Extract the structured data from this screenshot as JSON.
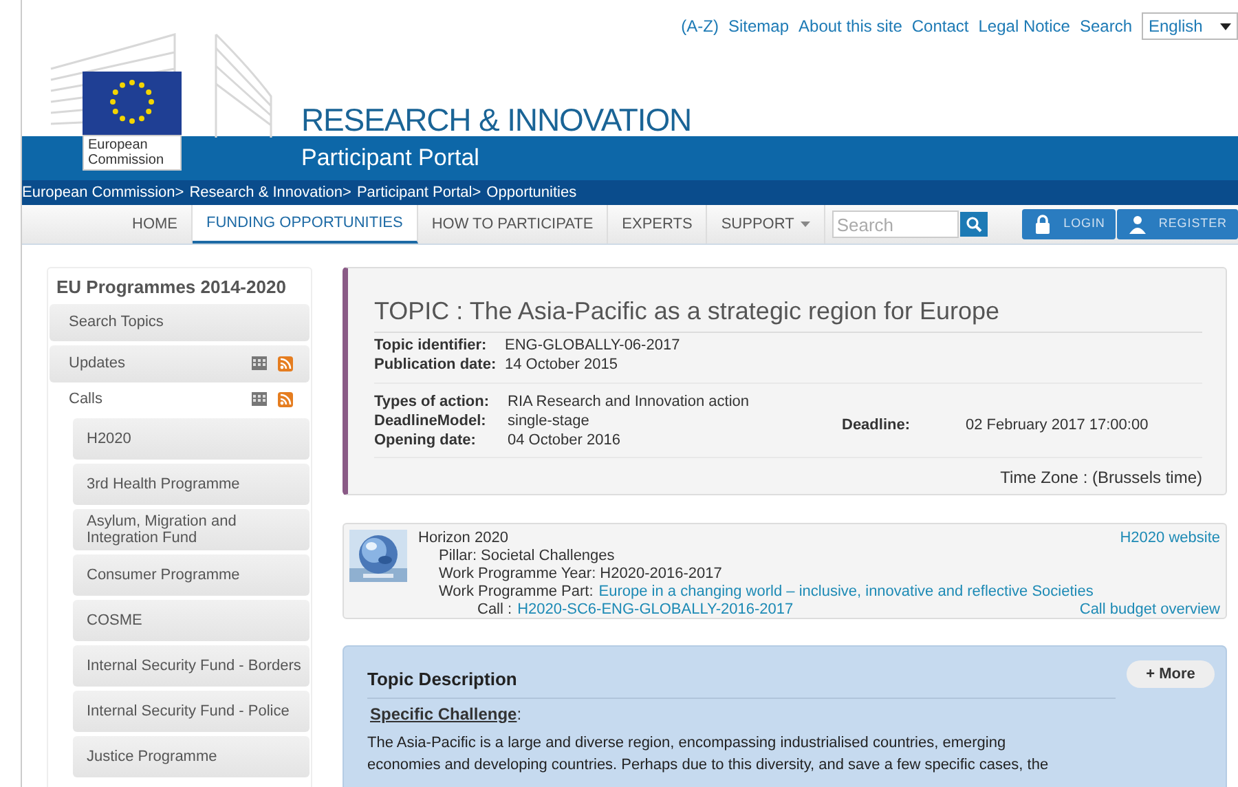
{
  "top_links": [
    "(A-Z)",
    "Sitemap",
    "About this site",
    "Contact",
    "Legal Notice",
    "Search"
  ],
  "language": {
    "value": "English"
  },
  "logo": {
    "line1": "European",
    "line2": "Commission"
  },
  "site_title": "RESEARCH & INNOVATION",
  "portal_title": "Participant Portal",
  "breadcrumb": [
    "European Commission",
    "Research & Innovation",
    "Participant Portal",
    "Opportunities"
  ],
  "breadcrumb_separator": ">",
  "nav": [
    {
      "label": "HOME",
      "selected": false,
      "dropdown": false
    },
    {
      "label": "FUNDING OPPORTUNITIES",
      "selected": true,
      "dropdown": false
    },
    {
      "label": "HOW TO PARTICIPATE",
      "selected": false,
      "dropdown": false
    },
    {
      "label": "EXPERTS",
      "selected": false,
      "dropdown": false
    },
    {
      "label": "SUPPORT",
      "selected": false,
      "dropdown": true
    }
  ],
  "search": {
    "placeholder": "Search"
  },
  "account_buttons": [
    {
      "label": "LOGIN",
      "kind": "lock"
    },
    {
      "label": "REGISTER",
      "kind": "user"
    }
  ],
  "sidebar": {
    "title": "EU Programmes 2014-2020",
    "items": [
      {
        "label": "Search Topics",
        "feeds": false
      },
      {
        "label": "Updates",
        "feeds": true
      },
      {
        "label": "Calls",
        "feeds": true,
        "children": [
          {
            "label": "H2020"
          },
          {
            "label": "3rd Health Programme"
          },
          {
            "label": "Asylum, Migration and Integration Fund"
          },
          {
            "label": "Consumer Programme"
          },
          {
            "label": "COSME"
          },
          {
            "label": "Internal Security Fund - Borders"
          },
          {
            "label": "Internal Security Fund - Police"
          },
          {
            "label": "Justice Programme"
          }
        ]
      }
    ]
  },
  "topic": {
    "title": "TOPIC : The Asia-Pacific as a strategic region for Europe",
    "fields_1": [
      {
        "label": "Topic identifier:",
        "value": "ENG-GLOBALLY-06-2017"
      },
      {
        "label": "Publication date:",
        "value": "14 October 2015"
      }
    ],
    "fields_2": [
      {
        "label": "Types of action:",
        "value": "RIA Research and Innovation action"
      },
      {
        "label": "DeadlineModel:",
        "value": "single-stage"
      },
      {
        "label": "Opening date:",
        "value": "04 October 2016"
      }
    ],
    "deadline": {
      "label": "Deadline:",
      "value": "02 February 2017 17:00:00"
    },
    "time_zone": "Time Zone : (Brussels time)"
  },
  "programme": {
    "name": "Horizon 2020",
    "pillar": "Pillar: Societal Challenges",
    "year": "Work Programme Year: H2020-2016-2017",
    "part_label": "Work Programme Part:",
    "part_link": "Europe in a changing world – inclusive, innovative and reflective Societies",
    "call_label": "Call :",
    "call_link": "H2020-SC6-ENG-GLOBALLY-2016-2017",
    "website_link": "H2020 website",
    "budget_link": "Call budget overview"
  },
  "description": {
    "heading": "Topic Description",
    "more_button": "+ More",
    "subheading": "**Specific Challenge**:",
    "text": "The Asia-Pacific is a large and diverse region, encompassing industrialised countries, emerging economies and developing countries. Perhaps due to this diversity, and save a few specific cases, the"
  }
}
